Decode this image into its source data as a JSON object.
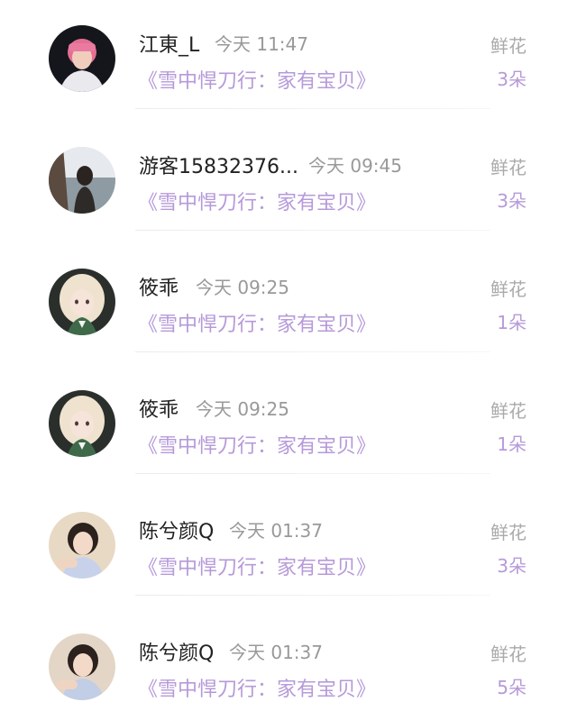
{
  "records": [
    {
      "user": "江東_L",
      "time": "今天 11:47",
      "book": "《雪中悍刀行：家有宝贝》",
      "gift_label": "鲜花",
      "gift_count": "3朵",
      "avatar": "avatar-pink-hair"
    },
    {
      "user": "游客15832376...",
      "time": "今天 09:45",
      "book": "《雪中悍刀行：家有宝贝》",
      "gift_label": "鲜花",
      "gift_count": "3朵",
      "avatar": "avatar-seaside"
    },
    {
      "user": "筱乖",
      "time": "今天 09:25",
      "book": "《雪中悍刀行：家有宝贝》",
      "gift_label": "鲜花",
      "gift_count": "1朵",
      "avatar": "avatar-blonde-illustration"
    },
    {
      "user": "筱乖",
      "time": "今天 09:25",
      "book": "《雪中悍刀行：家有宝贝》",
      "gift_label": "鲜花",
      "gift_count": "1朵",
      "avatar": "avatar-blonde-illustration"
    },
    {
      "user": "陈兮颜Q",
      "time": "今天 01:37",
      "book": "《雪中悍刀行：家有宝贝》",
      "gift_label": "鲜花",
      "gift_count": "3朵",
      "avatar": "avatar-girl-photo"
    },
    {
      "user": "陈兮颜Q",
      "time": "今天 01:37",
      "book": "《雪中悍刀行：家有宝贝》",
      "gift_label": "鲜花",
      "gift_count": "5朵",
      "avatar": "avatar-girl-photo"
    }
  ],
  "colors": {
    "name": "#222222",
    "time": "#999999",
    "accent_purple": "#b69ad9",
    "gift_label": "#aaaaaa"
  }
}
